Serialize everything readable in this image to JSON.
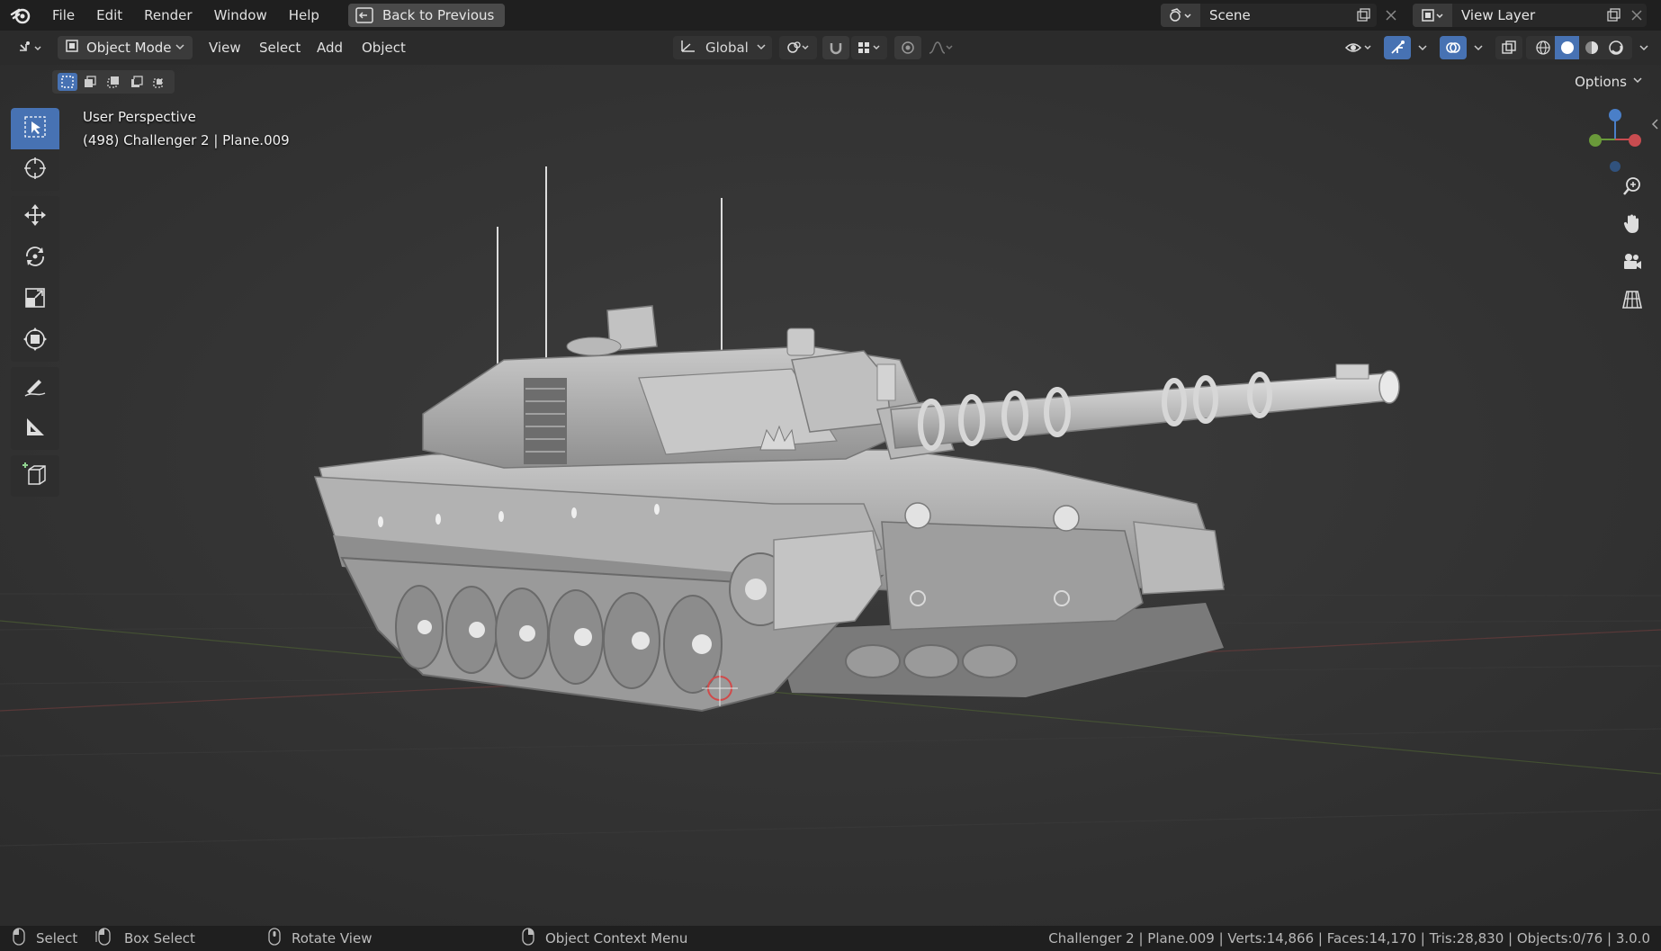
{
  "topbar": {
    "menus": [
      "File",
      "Edit",
      "Render",
      "Window",
      "Help"
    ],
    "back_button": "Back to Previous",
    "scene_label": "Scene",
    "view_layer_label": "View Layer"
  },
  "header": {
    "mode": "Object Mode",
    "menus": [
      "View",
      "Select",
      "Add",
      "Object"
    ],
    "orientation": "Global",
    "options": "Options"
  },
  "viewport": {
    "view_name": "User Perspective",
    "object_info": "(498) Challenger 2 | Plane.009"
  },
  "status": {
    "select": "Select",
    "box_select": "Box Select",
    "rotate_view": "Rotate View",
    "context_menu": "Object Context Menu",
    "stats": "Challenger 2 | Plane.009 | Verts:14,866 | Faces:14,170 | Tris:28,830 | Objects:0/76 | 3.0.0"
  },
  "colors": {
    "accent": "#4772b3",
    "background": "#2b2b2b",
    "bar": "#1f1f1f",
    "axis_x": "#c84c50",
    "axis_y": "#6a9a3a",
    "axis_z": "#4a7fc8"
  },
  "icons": {
    "tools": [
      "select-box-icon",
      "cursor-icon",
      "move-icon",
      "rotate-icon",
      "scale-icon",
      "transform-icon",
      "annotate-icon",
      "measure-icon",
      "add-cube-icon"
    ],
    "nav": [
      "zoom-icon",
      "hand-pan-icon",
      "camera-icon",
      "grid-icon"
    ]
  }
}
